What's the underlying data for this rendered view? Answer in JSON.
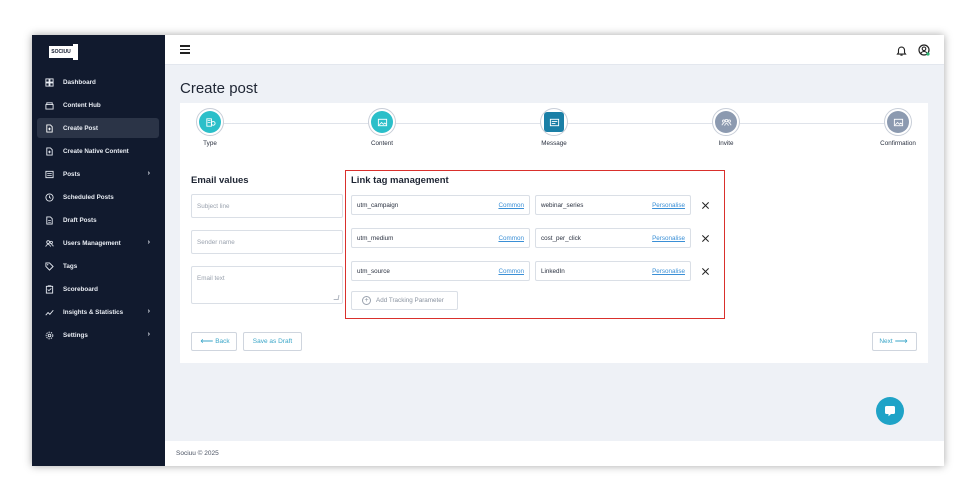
{
  "app": {
    "logo_text": "SOCIUU",
    "footer": "Sociuu © 2025"
  },
  "sidebar": {
    "items": [
      {
        "label": "Dashboard",
        "icon": "dashboard-icon",
        "active": false,
        "has_children": false
      },
      {
        "label": "Content Hub",
        "icon": "content-hub-icon",
        "active": false,
        "has_children": false
      },
      {
        "label": "Create Post",
        "icon": "create-post-icon",
        "active": true,
        "has_children": false
      },
      {
        "label": "Create Native Content",
        "icon": "native-content-icon",
        "active": false,
        "has_children": false
      },
      {
        "label": "Posts",
        "icon": "posts-icon",
        "active": false,
        "has_children": true
      },
      {
        "label": "Scheduled Posts",
        "icon": "clock-icon",
        "active": false,
        "has_children": false
      },
      {
        "label": "Draft Posts",
        "icon": "draft-icon",
        "active": false,
        "has_children": false
      },
      {
        "label": "Users Management",
        "icon": "users-icon",
        "active": false,
        "has_children": true
      },
      {
        "label": "Tags",
        "icon": "tag-icon",
        "active": false,
        "has_children": false
      },
      {
        "label": "Scoreboard",
        "icon": "scoreboard-icon",
        "active": false,
        "has_children": false
      },
      {
        "label": "Insights & Statistics",
        "icon": "chart-icon",
        "active": false,
        "has_children": true
      },
      {
        "label": "Settings",
        "icon": "gear-icon",
        "active": false,
        "has_children": true
      }
    ]
  },
  "page": {
    "title": "Create post"
  },
  "stepper": {
    "steps": [
      {
        "label": "Type",
        "state": "done"
      },
      {
        "label": "Content",
        "state": "done"
      },
      {
        "label": "Message",
        "state": "current"
      },
      {
        "label": "Invite",
        "state": "pending"
      },
      {
        "label": "Confirmation",
        "state": "pending"
      }
    ]
  },
  "email_values": {
    "title": "Email values",
    "subject_placeholder": "Subject line",
    "sender_placeholder": "Sender name",
    "text_placeholder": "Email text"
  },
  "link_tags": {
    "title": "Link tag management",
    "params": [
      {
        "key": "utm_campaign",
        "key_link": "Common",
        "value": "webinar_series",
        "value_link": "Personalise"
      },
      {
        "key": "utm_medium",
        "key_link": "Common",
        "value": "cost_per_click",
        "value_link": "Personalise"
      },
      {
        "key": "utm_source",
        "key_link": "Common",
        "value": "LinkedIn",
        "value_link": "Personalise"
      }
    ],
    "add_label": "Add Tracking Parameter"
  },
  "actions": {
    "back": "Back",
    "draft": "Save as Draft",
    "next": "Next"
  },
  "colors": {
    "sidebar_bg": "#111a2e",
    "accent": "#2bbfc9",
    "link": "#3a8fd6",
    "highlight_border": "#d9302c",
    "step_pending": "#8c9ab0",
    "step_current": "#1a7fa6"
  }
}
